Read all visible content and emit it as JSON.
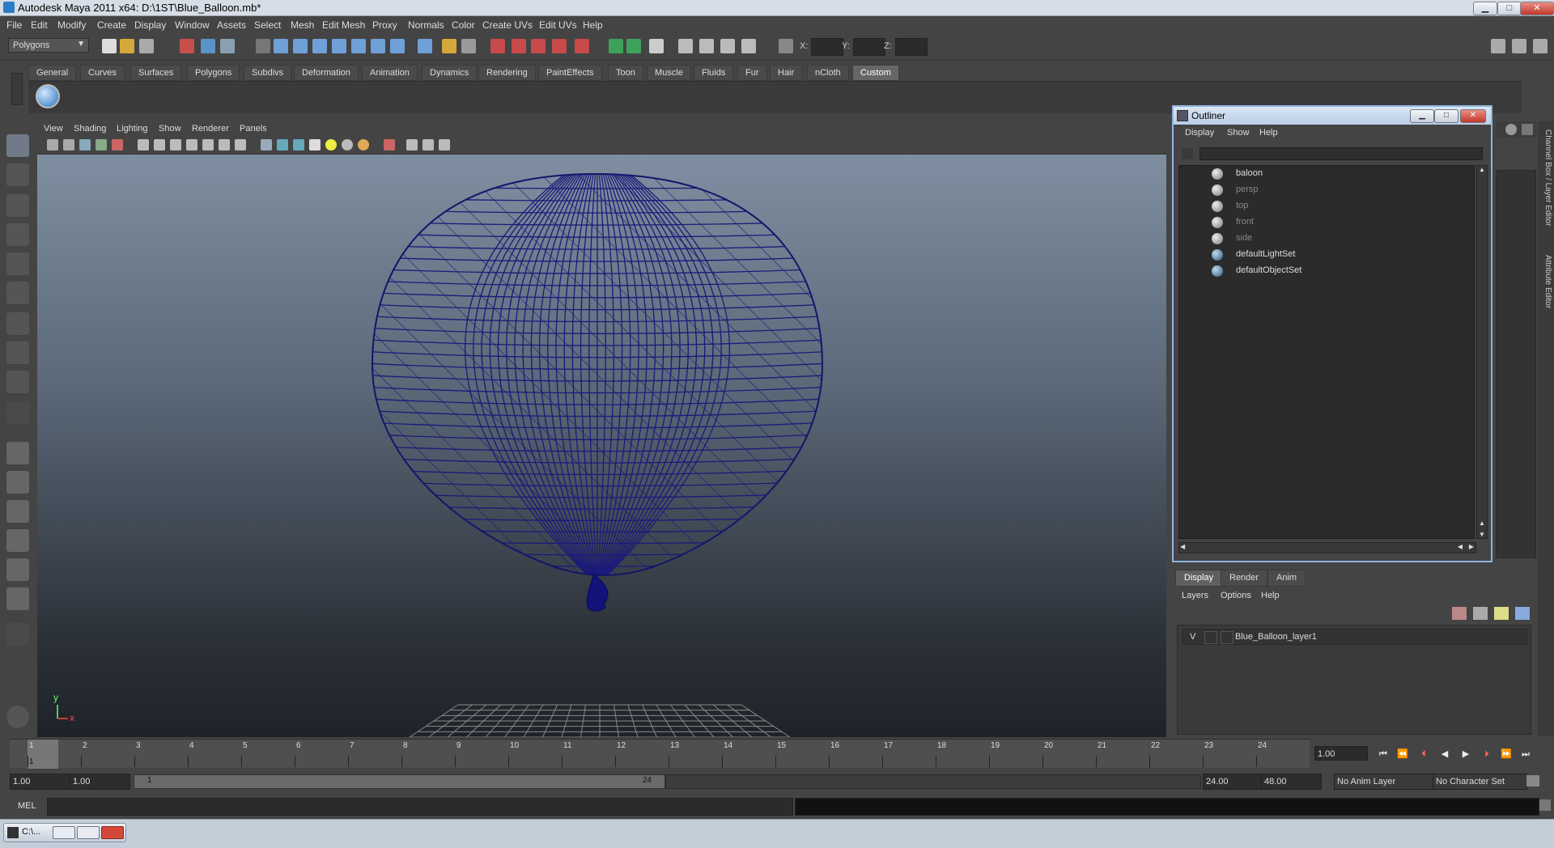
{
  "window": {
    "title": "Autodesk Maya 2011 x64: D:\\1ST\\Blue_Balloon.mb*",
    "btn_min": "▁",
    "btn_max": "□",
    "btn_close": "✕"
  },
  "menu": [
    "File",
    "Edit",
    "Modify",
    "Create",
    "Display",
    "Window",
    "Assets",
    "Select",
    "Mesh",
    "Edit Mesh",
    "Proxy",
    "Normals",
    "Color",
    "Create UVs",
    "Edit UVs",
    "Help"
  ],
  "toolbar": {
    "mode": "Polygons",
    "x_label": "X:",
    "y_label": "Y:",
    "z_label": "Z:"
  },
  "shelf_tabs": [
    "General",
    "Curves",
    "Surfaces",
    "Polygons",
    "Subdivs",
    "Deformation",
    "Animation",
    "Dynamics",
    "Rendering",
    "PaintEffects",
    "Toon",
    "Muscle",
    "Fluids",
    "Fur",
    "Hair",
    "nCloth",
    "Custom"
  ],
  "viewport": {
    "menu": [
      "View",
      "Shading",
      "Lighting",
      "Show",
      "Renderer",
      "Panels"
    ],
    "axis_y": "y",
    "axis_x": "x",
    "wire_color": "#1a1a7a"
  },
  "outliner": {
    "title": "Outliner",
    "menu": [
      "Display",
      "Show",
      "Help"
    ],
    "items": [
      {
        "label": "baloon",
        "dim": false
      },
      {
        "label": "persp",
        "dim": true
      },
      {
        "label": "top",
        "dim": true
      },
      {
        "label": "front",
        "dim": true
      },
      {
        "label": "side",
        "dim": true
      },
      {
        "label": "defaultLightSet",
        "dim": false
      },
      {
        "label": "defaultObjectSet",
        "dim": false
      }
    ]
  },
  "right_tabs": [
    "Channel Box / Layer Editor",
    "Attribute Editor"
  ],
  "layers": {
    "tabs": [
      "Display",
      "Render",
      "Anim"
    ],
    "menu": [
      "Layers",
      "Options",
      "Help"
    ],
    "row_visibility": "V",
    "row_name": "Blue_Balloon_layer1"
  },
  "timeline": {
    "ticks": [
      "1",
      "2",
      "3",
      "4",
      "5",
      "6",
      "7",
      "8",
      "9",
      "10",
      "11",
      "12",
      "13",
      "14",
      "15",
      "16",
      "17",
      "18",
      "19",
      "20",
      "21",
      "22",
      "23",
      "24"
    ],
    "current_frame_marker": "1",
    "current_frame": "1.00"
  },
  "range": {
    "start_time": "1.00",
    "playback_start": "1.00",
    "slider_start": "1",
    "slider_end": "24",
    "playback_end": "24.00",
    "end_time": "48.00",
    "anim_layer": "No Anim Layer",
    "character_set": "No Character Set"
  },
  "command": {
    "label": "MEL"
  },
  "taskbar": {
    "item": "C:\\..."
  }
}
